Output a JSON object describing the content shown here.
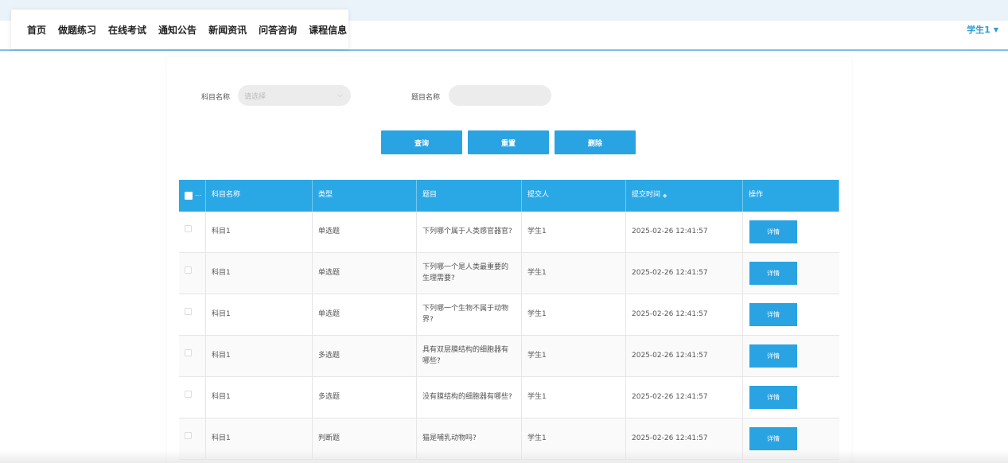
{
  "nav": {
    "items": [
      "首页",
      "做题练习",
      "在线考试",
      "通知公告",
      "新闻资讯",
      "问答咨询",
      "课程信息"
    ],
    "user": "学生1"
  },
  "search": {
    "subject_label": "科目名称",
    "subject_placeholder": "请选择",
    "question_label": "题目名称",
    "question_value": ""
  },
  "buttons": {
    "query": "查询",
    "reset": "重置",
    "delete": "删除"
  },
  "table": {
    "headers": [
      "科目名称",
      "类型",
      "题目",
      "提交人",
      "提交时间",
      "操作"
    ],
    "detail_label": "详情",
    "rows": [
      {
        "subject": "科目1",
        "type": "单选题",
        "question": "下列哪个属于人类感官器官?",
        "submitter": "学生1",
        "time": "2025-02-26 12:41:57"
      },
      {
        "subject": "科目1",
        "type": "单选题",
        "question": "下列哪一个是人类最重要的生理需要?",
        "submitter": "学生1",
        "time": "2025-02-26 12:41:57"
      },
      {
        "subject": "科目1",
        "type": "单选题",
        "question": "下列哪一个生物不属于动物界?",
        "submitter": "学生1",
        "time": "2025-02-26 12:41:57"
      },
      {
        "subject": "科目1",
        "type": "多选题",
        "question": "具有双层膜结构的细胞器有哪些?",
        "submitter": "学生1",
        "time": "2025-02-26 12:41:57"
      },
      {
        "subject": "科目1",
        "type": "多选题",
        "question": "没有膜结构的细胞器有哪些?",
        "submitter": "学生1",
        "time": "2025-02-26 12:41:57"
      },
      {
        "subject": "科目1",
        "type": "判断题",
        "question": "猫是哺乳动物吗?",
        "submitter": "学生1",
        "time": "2025-02-26 12:41:57"
      }
    ]
  },
  "colors": {
    "accent": "#2aa3e2",
    "header": "#2aa8e6",
    "user": "#2c9cd6"
  }
}
